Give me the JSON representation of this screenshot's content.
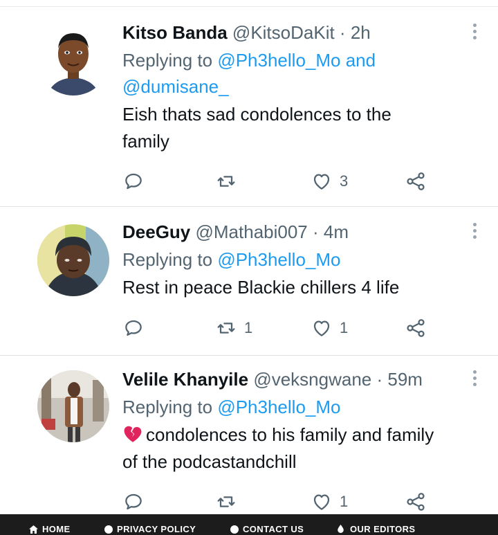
{
  "tweets": [
    {
      "name": "Kitso Banda",
      "handle": "@KitsoDaKit",
      "time": "2h",
      "replying_prefix": "Replying to ",
      "mentions": [
        "@Ph3hello_Mo",
        "@dumisane_"
      ],
      "mention_joiner": " and",
      "text_lines": [
        "Eish thats sad condolences to the",
        "family"
      ],
      "retweets": "",
      "likes": "3"
    },
    {
      "name": "DeeGuy",
      "handle": "@Mathabi007",
      "time": "4m",
      "replying_prefix": "Replying to ",
      "mentions": [
        "@Ph3hello_Mo"
      ],
      "text_lines": [
        "Rest in peace Blackie  chillers 4 life"
      ],
      "retweets": "1",
      "likes": "1"
    },
    {
      "name": "Velile Khanyile",
      "handle": "@veksngwane",
      "time": "59m",
      "replying_prefix": "Replying to ",
      "mentions": [
        "@Ph3hello_Mo"
      ],
      "text_lines": [
        "condolences to his family and family",
        "of the podcastandchill"
      ],
      "retweets": "",
      "likes": "1"
    }
  ],
  "separator": " · ",
  "footer": {
    "items": [
      {
        "label": "HOME",
        "icon": "home-icon"
      },
      {
        "label": "PRIVACY POLICY",
        "icon": "privacy-icon"
      },
      {
        "label": "CONTACT US",
        "icon": "contact-icon"
      },
      {
        "label": "OUR EDITORS",
        "icon": "editors-icon"
      }
    ]
  },
  "colors": {
    "mention": "#1d9bf0",
    "muted": "#536471",
    "footer_bg": "#1c1c1c",
    "broken_heart": "#e0245e"
  }
}
